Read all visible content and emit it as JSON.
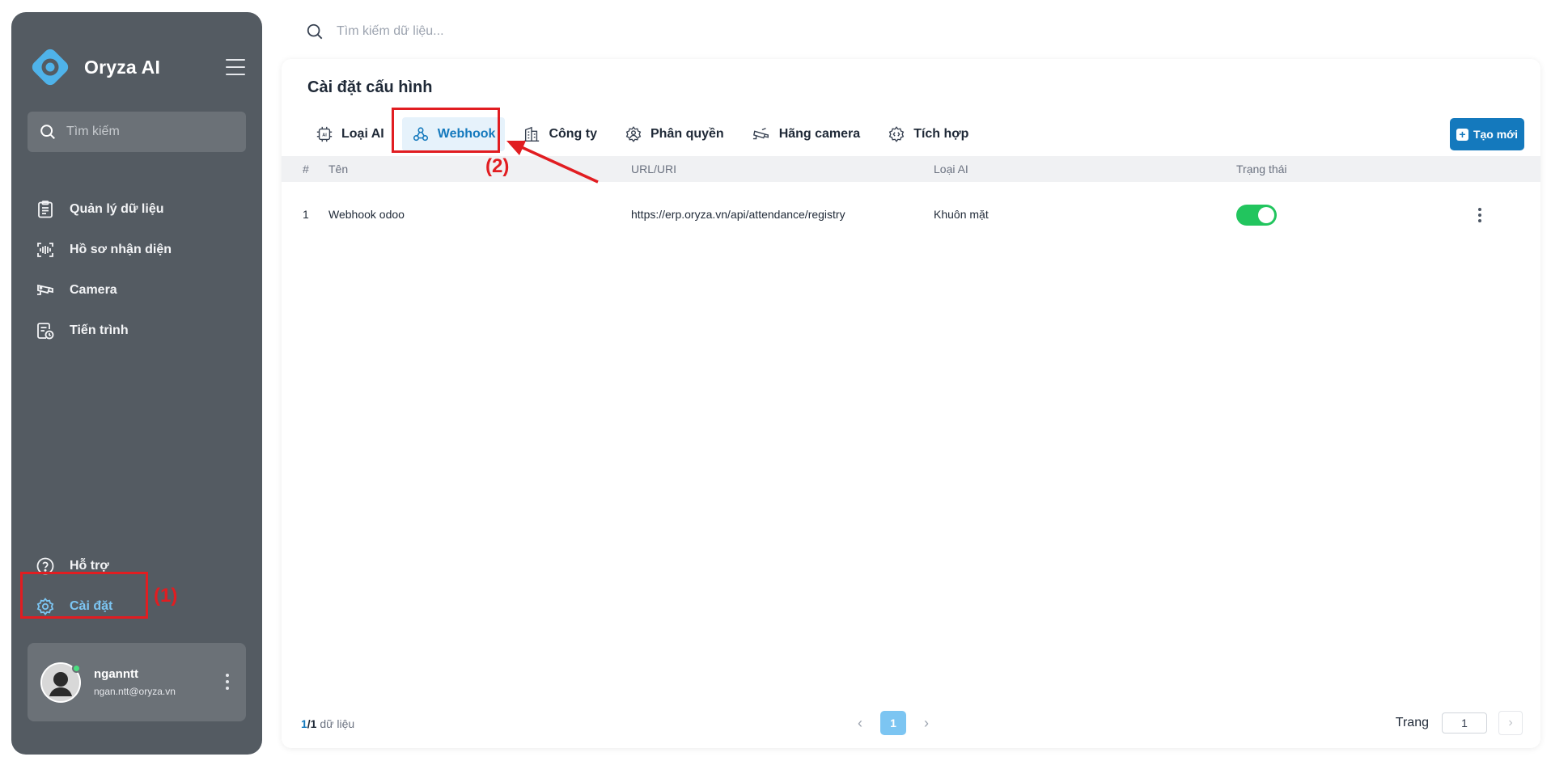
{
  "app": {
    "name": "Oryza AI",
    "colors": {
      "accent": "#1479bd",
      "sidebar": "#545b62",
      "active_text": "#7cc5f2",
      "status_on": "#22c55e",
      "annotation": "#e11d21"
    }
  },
  "sidebar": {
    "search_placeholder": "Tìm kiếm",
    "nav_top": [
      {
        "label": "Quản lý dữ liệu",
        "icon": "clipboard-icon"
      },
      {
        "label": "Hồ sơ nhận diện",
        "icon": "face-scan-icon"
      },
      {
        "label": "Camera",
        "icon": "camera-icon"
      },
      {
        "label": "Tiến trình",
        "icon": "process-icon"
      }
    ],
    "nav_bottom": [
      {
        "label": "Hỗ trợ",
        "icon": "help-icon"
      },
      {
        "label": "Cài đặt",
        "icon": "gear-icon",
        "active": true
      }
    ],
    "user": {
      "name": "nganntt",
      "email": "ngan.ntt@oryza.vn",
      "status": "online"
    }
  },
  "top_search": {
    "placeholder": "Tìm kiếm dữ liệu..."
  },
  "main": {
    "title": "Cài đặt cấu hình",
    "tabs": [
      {
        "label": "Loại AI",
        "icon": "ai-chip-icon"
      },
      {
        "label": "Webhook",
        "icon": "webhook-icon",
        "active": true
      },
      {
        "label": "Công ty",
        "icon": "building-icon"
      },
      {
        "label": "Phân quyền",
        "icon": "user-shield-icon"
      },
      {
        "label": "Hãng camera",
        "icon": "cctv-icon"
      },
      {
        "label": "Tích hợp",
        "icon": "integration-icon"
      }
    ],
    "create_button": "Tạo mới",
    "table": {
      "headers": [
        "#",
        "Tên",
        "URL/URI",
        "Loại AI",
        "Trạng thái"
      ],
      "rows": [
        {
          "index": "1",
          "name": "Webhook odoo",
          "url": "https://erp.oryza.vn/api/attendance/registry",
          "ai_type": "Khuôn mặt",
          "enabled": true
        }
      ]
    },
    "footer": {
      "count_current": "1",
      "count_total": "/1",
      "count_suffix": " dữ liệu",
      "current_page": "1",
      "goto_label": "Trang",
      "goto_value": "1"
    }
  },
  "annotations": {
    "label_1": "(1)",
    "label_2": "(2)"
  }
}
